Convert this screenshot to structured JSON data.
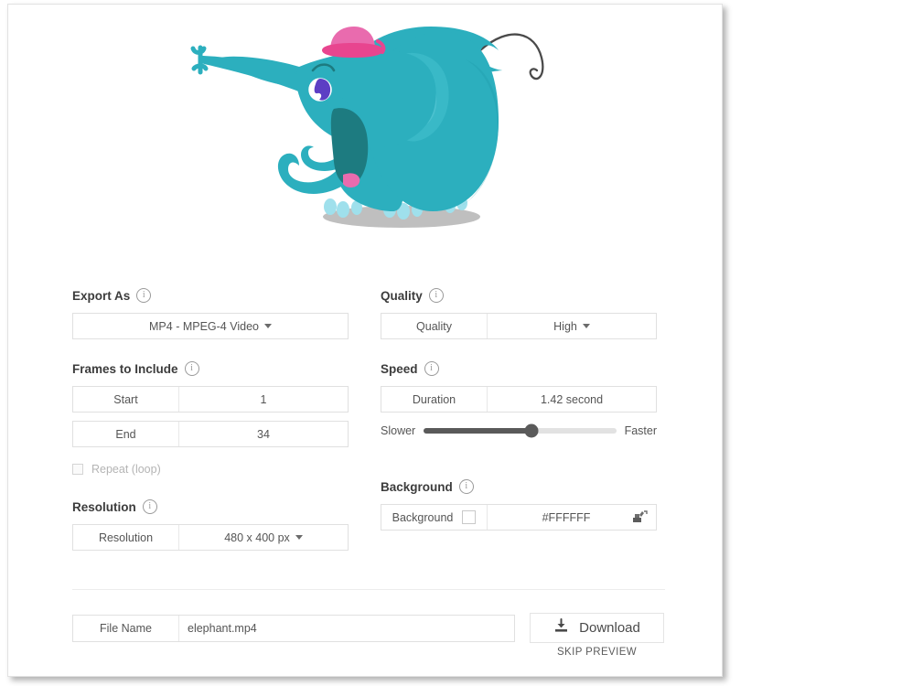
{
  "illustration": {
    "name": "elephant-cartoon",
    "body_color": "#2CAFBE",
    "body_shade": "#22A0B0",
    "hat_color": "#E96BAE",
    "hat_brim_color": "#E8458F",
    "mouth_color": "#1D7B80",
    "tongue_color": "#E96BAE",
    "eye_pupil_color": "#5C3FC4",
    "toenail_color": "#9FE0EC",
    "shadow_color": "#A9A9A9",
    "tail_color": "#4A4A4A"
  },
  "export_as": {
    "label": "Export As",
    "info_icon": "info-icon",
    "value": "MP4 - MPEG-4 Video",
    "caret_icon": "chevron-down-icon"
  },
  "quality": {
    "label": "Quality",
    "info_icon": "info-icon",
    "field_label": "Quality",
    "value": "High",
    "caret_icon": "chevron-down-icon"
  },
  "frames": {
    "label": "Frames to Include",
    "info_icon": "info-icon",
    "start_label": "Start",
    "start_value": "1",
    "end_label": "End",
    "end_value": "34",
    "repeat_label": "Repeat (loop)",
    "repeat_checked": false
  },
  "speed": {
    "label": "Speed",
    "info_icon": "info-icon",
    "duration_label": "Duration",
    "duration_value": "1.42 second",
    "slower_label": "Slower",
    "faster_label": "Faster",
    "slider_percent": 56
  },
  "resolution": {
    "label": "Resolution",
    "info_icon": "info-icon",
    "field_label": "Resolution",
    "value": "480 x 400 px",
    "caret_icon": "chevron-down-icon"
  },
  "background": {
    "label": "Background",
    "info_icon": "info-icon",
    "field_label": "Background",
    "swatch_color": "#FFFFFF",
    "hex_value": "#FFFFFF",
    "picker_icon": "color-picker-icon"
  },
  "file": {
    "name_label": "File Name",
    "name_value": "elephant.mp4",
    "download_label": "Download",
    "download_icon": "download-icon",
    "skip_preview_label": "SKIP PREVIEW"
  }
}
